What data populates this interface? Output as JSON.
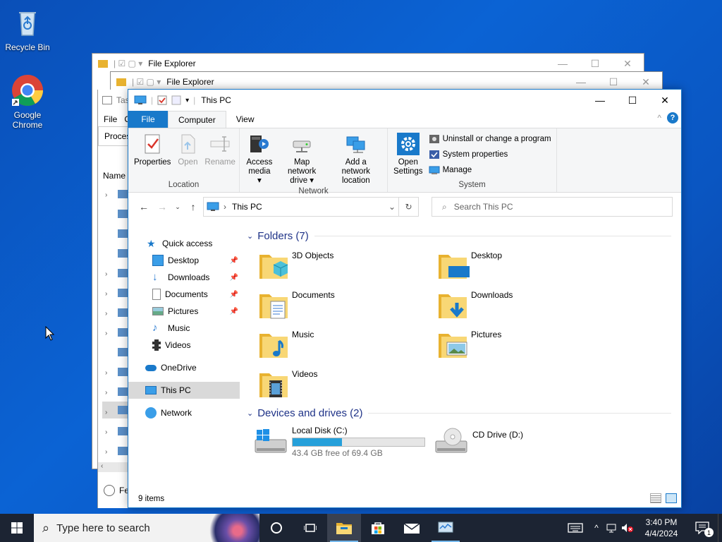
{
  "desktop": {
    "icons": [
      {
        "label": "Recycle Bin"
      },
      {
        "label": "Google\nChrome"
      }
    ]
  },
  "bg_windows": {
    "back": {
      "title": "File Explorer"
    },
    "middle": {
      "title": "File Explorer"
    },
    "task_fragment": {
      "tab": "Tas",
      "menu_file": "File",
      "menu_o": "O",
      "tab_proc": "Proces",
      "col_name": "Name",
      "footer": "Fe"
    }
  },
  "window": {
    "title": "This PC",
    "tabs": [
      "File",
      "Computer",
      "View"
    ],
    "ribbon": {
      "location": {
        "label": "Location",
        "buttons": [
          {
            "label": "Properties",
            "disabled": false
          },
          {
            "label": "Open",
            "disabled": true
          },
          {
            "label": "Rename",
            "disabled": true
          }
        ]
      },
      "network": {
        "label": "Network",
        "buttons": [
          {
            "line1": "Access",
            "line2": "media ▾"
          },
          {
            "line1": "Map network",
            "line2": "drive ▾"
          },
          {
            "line1": "Add a network",
            "line2": "location"
          }
        ]
      },
      "system": {
        "label": "System",
        "open_settings": {
          "line1": "Open",
          "line2": "Settings"
        },
        "small": [
          "Uninstall or change a program",
          "System properties",
          "Manage"
        ]
      }
    },
    "address": {
      "path": "This PC",
      "search_placeholder": "Search This PC"
    },
    "nav": {
      "quick_access": "Quick access",
      "pinned": [
        "Desktop",
        "Downloads",
        "Documents",
        "Pictures"
      ],
      "unpinned": [
        "Music",
        "Videos"
      ],
      "onedrive": "OneDrive",
      "this_pc": "This PC",
      "network": "Network"
    },
    "folders_header": "Folders (7)",
    "folders": [
      "3D Objects",
      "Desktop",
      "Documents",
      "Downloads",
      "Music",
      "Pictures",
      "Videos"
    ],
    "drives_header": "Devices and drives (2)",
    "drives": [
      {
        "name": "Local Disk (C:)",
        "free": "43.4 GB free of 69.4 GB",
        "used_fraction": 0.375
      },
      {
        "name": "CD Drive (D:)"
      }
    ],
    "status": "9 items"
  },
  "taskbar": {
    "search_placeholder": "Type here to search",
    "time": "3:40 PM",
    "date": "4/4/2024",
    "notification_count": "1"
  },
  "colors": {
    "accent": "#1979ca",
    "heading": "#1e3287",
    "disk_bar": "#26a0da"
  }
}
